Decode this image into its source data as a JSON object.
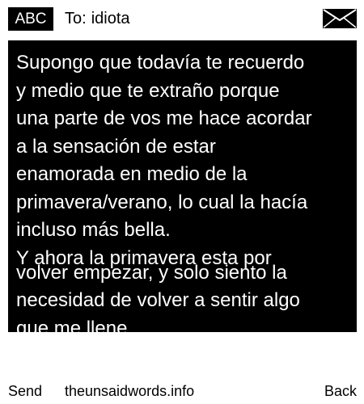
{
  "header": {
    "input_mode": "ABC",
    "recipient_label": "To:",
    "recipient_name": "idiota",
    "message_icon": "envelope-icon"
  },
  "message": {
    "lines": [
      "Supongo que todavía te recuerdo",
      "y medio que te extraño porque",
      "una parte de vos me hace acordar",
      "a la sensación de estar",
      "enamorada en medio de la",
      "primavera/verano, lo cual la hacía",
      "incluso más bella.",
      "Y ahora la primavera esta por",
      "volver empezar, y solo siento la",
      "necesidad de volver a sentir algo",
      "que me llene ."
    ]
  },
  "soft_keys": {
    "left": "Send",
    "center": "theunsaidwords.info",
    "right": "Back"
  },
  "colors": {
    "background": "#ffffff",
    "message_background": "#000000",
    "message_text": "#ffffff",
    "text": "#000000"
  }
}
